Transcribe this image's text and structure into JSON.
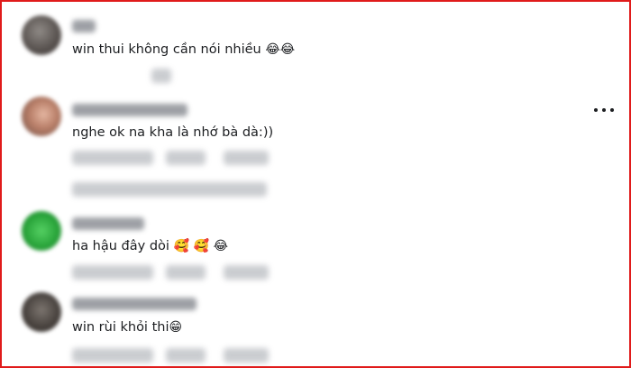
{
  "comments": [
    {
      "text": "win thui không cần nói nhiều",
      "emojis": [
        "😂",
        "😂"
      ]
    },
    {
      "text": "nghe ok na kha là nhớ bà dà:))",
      "emojis": []
    },
    {
      "text": "ha hậu đây dòi",
      "emojis": [
        "🥰",
        "🥰",
        "😂"
      ]
    },
    {
      "text": "win rùi khỏi thi",
      "emojis": [
        "😁"
      ]
    }
  ],
  "icons": {
    "more": "more-options-icon"
  },
  "colors": {
    "border": "#e01b1b",
    "text": "#1c1e21",
    "blur": "#b9bcc1"
  }
}
